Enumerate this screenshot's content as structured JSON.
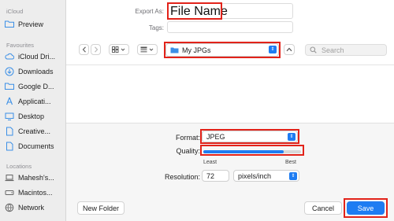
{
  "sidebar": {
    "icloud_header": "iCloud",
    "favourites_header": "Favourites",
    "locations_header": "Locations",
    "icloud_items": [
      {
        "label": "Preview",
        "icon": "folder-icon"
      }
    ],
    "favourite_items": [
      {
        "label": "iCloud Dri...",
        "icon": "cloud-icon"
      },
      {
        "label": "Downloads",
        "icon": "download-icon"
      },
      {
        "label": "Google D...",
        "icon": "folder-icon"
      },
      {
        "label": "Applicati...",
        "icon": "apps-icon"
      },
      {
        "label": "Desktop",
        "icon": "desktop-icon"
      },
      {
        "label": "Creative...",
        "icon": "document-icon"
      },
      {
        "label": "Documents",
        "icon": "document-icon"
      }
    ],
    "location_items": [
      {
        "label": "Mahesh's...",
        "icon": "laptop-icon"
      },
      {
        "label": "Macintos...",
        "icon": "disk-icon"
      },
      {
        "label": "Network",
        "icon": "globe-icon"
      }
    ]
  },
  "header": {
    "export_as_label": "Export As:",
    "export_as_value": "File Name",
    "tags_label": "Tags:",
    "tags_value": ""
  },
  "toolbar": {
    "location": "My JPGs",
    "search_placeholder": "Search"
  },
  "options": {
    "format_label": "Format:",
    "format_value": "JPEG",
    "quality_label": "Quality:",
    "quality_level": 0.82,
    "quality_min_label": "Least",
    "quality_max_label": "Best",
    "resolution_label": "Resolution:",
    "resolution_value": "72",
    "resolution_unit": "pixels/inch"
  },
  "footer": {
    "new_folder_label": "New Folder",
    "cancel_label": "Cancel",
    "save_label": "Save"
  },
  "colors": {
    "accent": "#1e7cf2",
    "highlight": "#e2231a"
  }
}
